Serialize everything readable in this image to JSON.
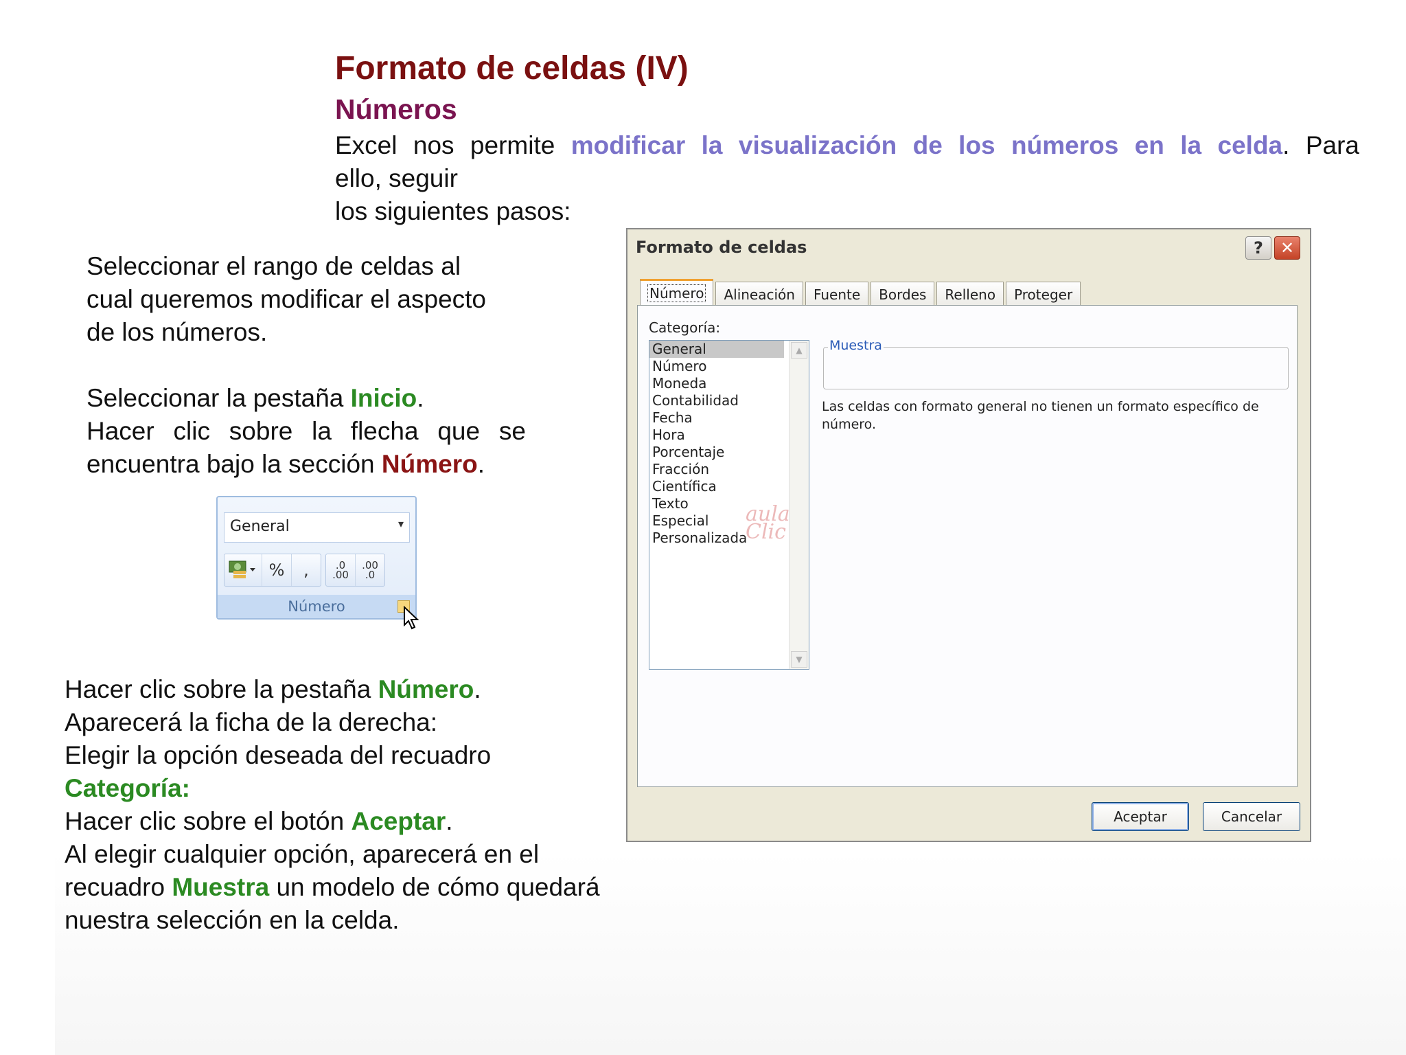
{
  "slide": {
    "title": "Formato de celdas (IV)",
    "subtitle": "Números",
    "intro": {
      "pre": "Excel nos permite ",
      "highlight": "modificar la visualización de los números en la celda",
      "post": ". Para",
      "line2": "ello, seguir",
      "line3": "los siguientes pasos:"
    },
    "step1": {
      "line1": "Seleccionar el rango de celdas al",
      "line2": "cual queremos modificar el aspecto",
      "line3": "de los números."
    },
    "step2": {
      "pre": "Seleccionar la pestaña ",
      "bold": "Inicio",
      "post": ".",
      "line2": "Hacer clic sobre la flecha que se",
      "line3_pre": "encuentra bajo la sección ",
      "line3_bold": "Número",
      "line3_post": "."
    },
    "step3": {
      "l1_pre": "Hacer clic sobre la pestaña ",
      "l1_bold": "Número",
      "l1_post": ".",
      "l2": "Aparecerá la ficha de la derecha:",
      "l3": "Elegir la opción deseada del recuadro",
      "l4_bold": "Categoría:",
      "l5_pre": "Hacer clic sobre el botón ",
      "l5_bold": "Aceptar",
      "l5_post": ".",
      "l6": "Al elegir cualquier opción, aparecerá en el",
      "l7_pre": "recuadro ",
      "l7_bold": "Muestra",
      "l7_post": " un modelo de cómo quedará",
      "l8": "nuestra selección en la celda."
    }
  },
  "ribbon": {
    "format_value": "General",
    "buttons": [
      "$",
      "%",
      ",",
      ".0 .00",
      ".00 .0"
    ],
    "group_label": "Número",
    "icons": [
      "currency-icon",
      "percent-icon",
      "comma-style-icon",
      "increase-decimal-icon",
      "decrease-decimal-icon",
      "dialog-launcher-icon",
      "mouse-cursor-icon"
    ]
  },
  "dialog": {
    "title": "Formato de celdas",
    "help": "?",
    "close": "✕",
    "tabs": [
      "Número",
      "Alineación",
      "Fuente",
      "Bordes",
      "Relleno",
      "Proteger"
    ],
    "active_tab": "Número",
    "category_label": "Categoría:",
    "categories": [
      "General",
      "Número",
      "Moneda",
      "Contabilidad",
      "Fecha",
      "Hora",
      "Porcentaje",
      "Fracción",
      "Científica",
      "Texto",
      "Especial",
      "Personalizada"
    ],
    "selected_category": "General",
    "sample_label": "Muestra",
    "description": "Las celdas con formato general no tienen un formato específico de número.",
    "watermark": "aula Clic",
    "ok_label": "Aceptar",
    "cancel_label": "Cancelar"
  },
  "colors": {
    "title": "#7a1010",
    "subtitle": "#7a1450",
    "highlight": "#7b73c9",
    "green": "#2b8a22",
    "red": "#8a1414"
  }
}
